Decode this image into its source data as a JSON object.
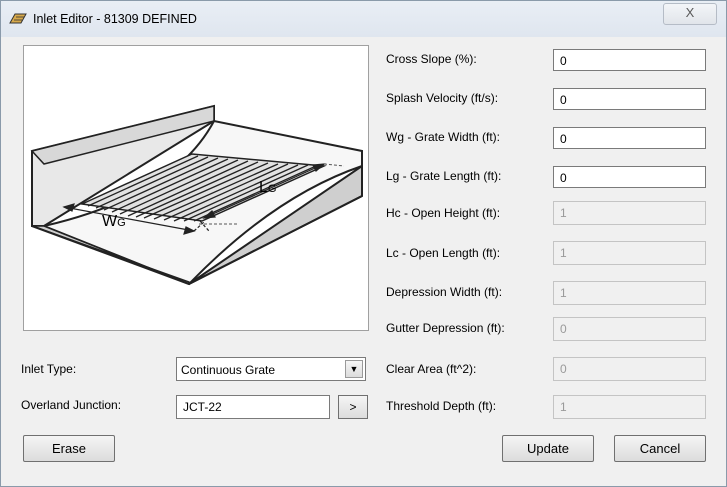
{
  "window": {
    "title": "Inlet Editor - 81309 DEFINED",
    "close": "X"
  },
  "diagram": {
    "lg_label": "L",
    "lg_sub": "G",
    "wg_label": "W",
    "wg_sub": "G"
  },
  "fields": [
    {
      "label": "Cross Slope (%):",
      "value": "0",
      "enabled": true
    },
    {
      "label": "Splash Velocity (ft/s):",
      "value": "0",
      "enabled": true
    },
    {
      "label": "Wg - Grate Width (ft):",
      "value": "0",
      "enabled": true
    },
    {
      "label": "Lg - Grate Length (ft):",
      "value": "0",
      "enabled": true
    },
    {
      "label": "Hc - Open Height (ft):",
      "value": "1",
      "enabled": false
    },
    {
      "label": "Lc - Open Length (ft):",
      "value": "1",
      "enabled": false
    },
    {
      "label": "Depression Width (ft):",
      "value": "1",
      "enabled": false
    },
    {
      "label": "Gutter Depression (ft):",
      "value": "0",
      "enabled": false
    },
    {
      "label": "Clear Area (ft^2):",
      "value": "0",
      "enabled": false
    },
    {
      "label": "Threshold Depth (ft):",
      "value": "1",
      "enabled": false
    }
  ],
  "inlet_type": {
    "label": "Inlet Type:",
    "value": "Continuous Grate"
  },
  "overland": {
    "label": "Overland Junction:",
    "value": "JCT-22",
    "button": ">"
  },
  "buttons": {
    "erase": "Erase",
    "update": "Update",
    "cancel": "Cancel"
  }
}
